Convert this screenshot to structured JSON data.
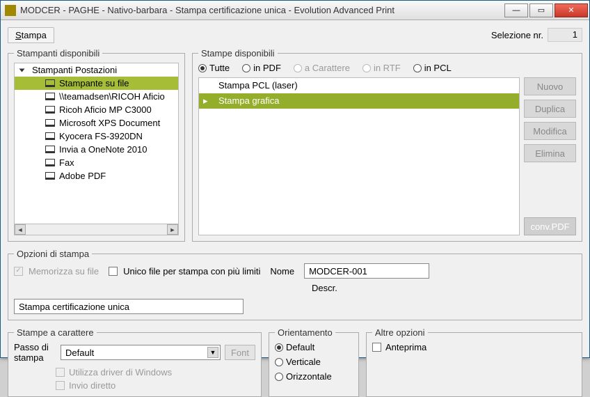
{
  "window": {
    "title": "MODCER - PAGHE - Nativo-barbara - Stampa certificazione unica - Evolution Advanced Print"
  },
  "menu": {
    "stampa": "Stampa",
    "stampa_underline": "S",
    "stampa_rest": "tampa"
  },
  "selection": {
    "label": "Selezione nr.",
    "value": "1"
  },
  "printers": {
    "legend": "Stampanti disponibili",
    "root": "Stampanti Postazioni",
    "items": [
      "Stampante su file",
      "\\\\teamadsen\\RICOH Aficio",
      "Ricoh Aficio MP C3000",
      "Microsoft XPS Document",
      "Kyocera FS-3920DN",
      "Invia a OneNote 2010",
      "Fax",
      "Adobe PDF"
    ],
    "selected_index": 0
  },
  "stampe": {
    "legend": "Stampe disponibili",
    "filters": {
      "tutte": "Tutte",
      "inpdf": "in PDF",
      "carattere": "a Carattere",
      "inrtf": "in RTF",
      "inpcl": "in PCL"
    },
    "list": [
      "Stampa PCL (laser)",
      "Stampa grafica"
    ],
    "selected_index": 1,
    "buttons": {
      "nuovo": "Nuovo",
      "duplica": "Duplica",
      "modifica": "Modifica",
      "elimina": "Elimina",
      "conv": "conv.PDF"
    }
  },
  "opts": {
    "legend": "Opzioni di stampa",
    "memorizza": "Memorizza su file",
    "unico": "Unico file per stampa con più limiti",
    "nome_label": "Nome",
    "nome_value": "MODCER-001",
    "descr_label": "Descr.",
    "descr_value": "Stampa certificazione unica"
  },
  "char": {
    "legend": "Stampe a carattere",
    "passo": "Passo di stampa",
    "combo_value": "Default",
    "font_btn": "Font",
    "driver": "Utilizza driver di Windows",
    "invio": "Invio diretto"
  },
  "orient": {
    "legend": "Orientamento",
    "default": "Default",
    "verticale": "Verticale",
    "orizzontale": "Orizzontale"
  },
  "altre": {
    "legend": "Altre opzioni",
    "anteprima": "Anteprima"
  }
}
